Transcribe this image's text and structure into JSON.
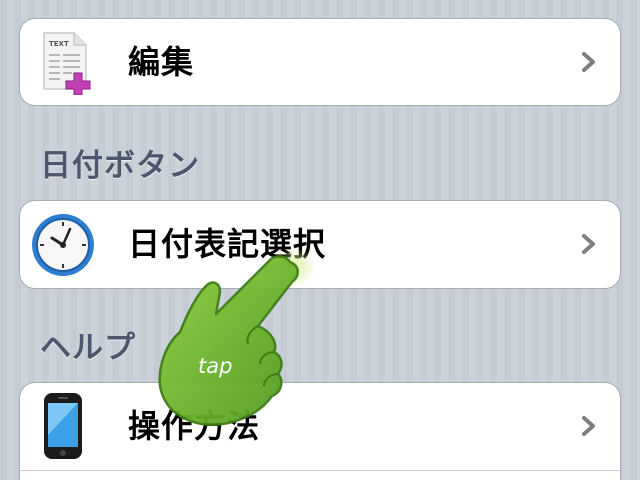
{
  "rows": {
    "edit": {
      "label": "編集",
      "icon": "text-document-add-icon"
    },
    "date_format": {
      "label": "日付表記選択",
      "icon": "clock-icon"
    },
    "how_to": {
      "label": "操作方法",
      "icon": "iphone-icon"
    }
  },
  "sections": {
    "date_button": "日付ボタン",
    "help": "ヘルプ"
  },
  "overlay": {
    "gesture_label": "tap",
    "icon": "tap-hand-icon"
  },
  "icon_text": {
    "document": "TEXT"
  },
  "colors": {
    "background": "#c5ccd4",
    "section_header": "#4c566c",
    "hand_green": "#6cb52d",
    "plus_magenta": "#c23fb5"
  }
}
